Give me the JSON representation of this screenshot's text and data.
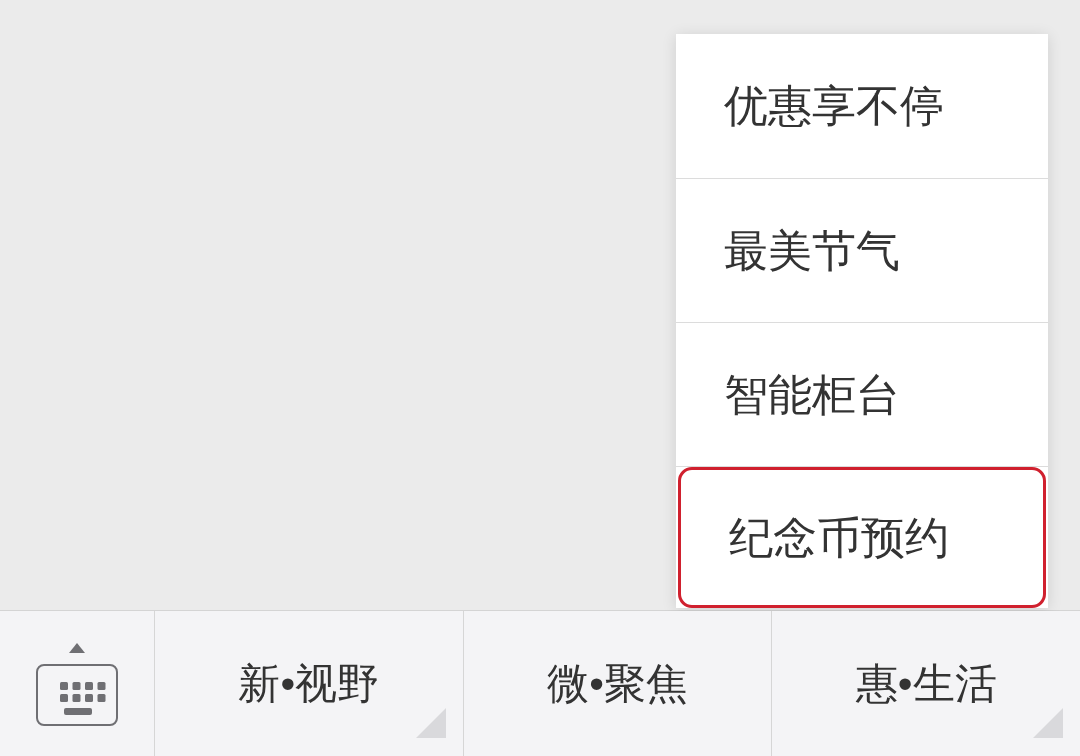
{
  "popup_menu": {
    "items": [
      {
        "label": "优惠享不停",
        "highlighted": false
      },
      {
        "label": "最美节气",
        "highlighted": false
      },
      {
        "label": "智能柜台",
        "highlighted": false
      },
      {
        "label": "纪念币预约",
        "highlighted": true
      }
    ]
  },
  "bottom_bar": {
    "tabs": [
      {
        "label": "新•视野",
        "submenu": true
      },
      {
        "label": "微•聚焦",
        "submenu": false
      },
      {
        "label": "惠•生活",
        "submenu": true
      }
    ]
  }
}
